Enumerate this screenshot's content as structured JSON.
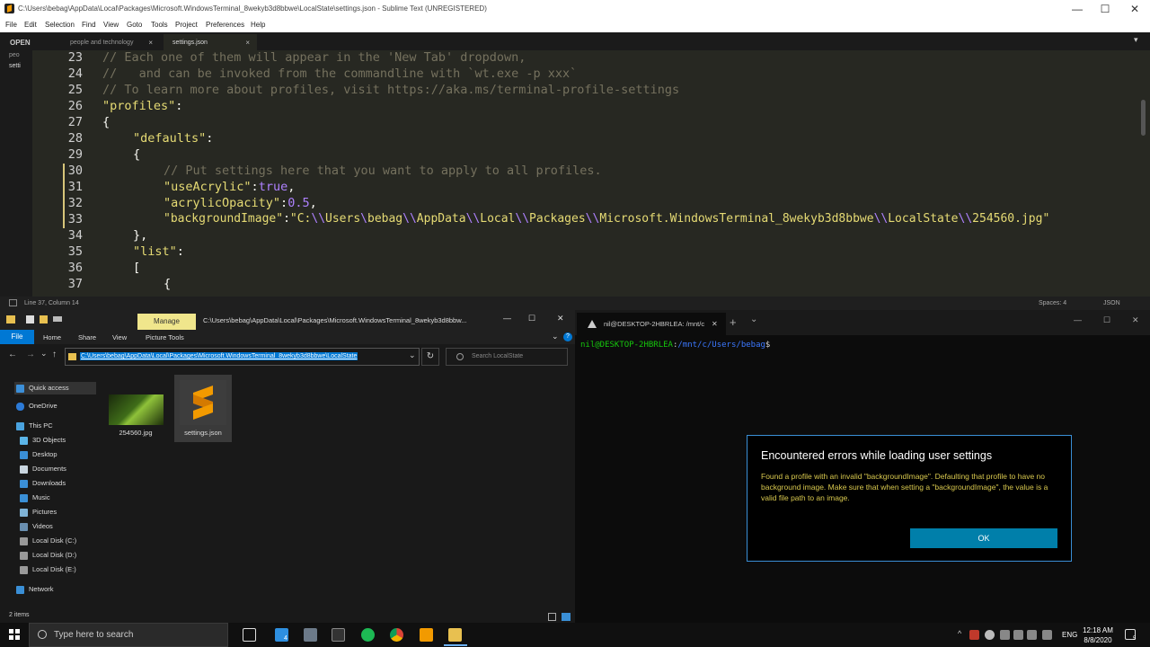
{
  "sublime": {
    "title": "C:\\Users\\bebag\\AppData\\Local\\Packages\\Microsoft.WindowsTerminal_8wekyb3d8bbwe\\LocalState\\settings.json - Sublime Text (UNREGISTERED)",
    "menu": [
      "File",
      "Edit",
      "Selection",
      "Find",
      "View",
      "Goto",
      "Tools",
      "Project",
      "Preferences",
      "Help"
    ],
    "sidebar_header": "OPEN",
    "sidebar_items": [
      "peo",
      "setti"
    ],
    "tabs": [
      {
        "label": "people and technology",
        "close": "×"
      },
      {
        "label": "settings.json",
        "close": "×"
      }
    ],
    "line_numbers": [
      "23",
      "24",
      "25",
      "26",
      "27",
      "28",
      "29",
      "30",
      "31",
      "32",
      "33",
      "34",
      "35",
      "36",
      "37"
    ],
    "status_left": "Line 37, Column 14",
    "status_spaces": "Spaces: 4",
    "status_syntax": "JSON",
    "win_min": "—",
    "win_max": "☐",
    "win_close": "✕",
    "tab_dropdown": "▾"
  },
  "code": {
    "l23": "// Each one of them will appear in the 'New Tab' dropdown,",
    "l24": "//   and can be invoked from the commandline with `wt.exe -p xxx`",
    "l25": "// To learn more about profiles, visit https://aka.ms/terminal-profile-settings",
    "l26_key": "\"profiles\"",
    "l26_colon": ":",
    "l27": "{",
    "l28_key": "\"defaults\"",
    "l28_colon": ":",
    "l29": "{",
    "l30": "// Put settings here that you want to apply to all profiles.",
    "l31_key": "\"useAcrylic\"",
    "l31_colon": ":",
    "l31_val": "true",
    "l31_comma": ",",
    "l32_key": "\"acrylicOpacity\"",
    "l32_colon": ":",
    "l32_val": "0.5",
    "l32_comma": ",",
    "l33_key": "\"backgroundImage\"",
    "l33_colon": ":",
    "l33_p1": "\"C:",
    "l33_e1": "\\\\",
    "l33_p2": "Users",
    "l33_e2": "\\",
    "l33_p3": "bebag",
    "l33_e3": "\\\\",
    "l33_p4": "AppData",
    "l33_e4": "\\\\",
    "l33_p5": "Local",
    "l33_e5": "\\\\",
    "l33_p6": "Packages",
    "l33_e6": "\\\\",
    "l33_p7": "Microsoft.WindowsTerminal_8wekyb3d8bbwe",
    "l33_e7": "\\\\",
    "l33_p8": "LocalState",
    "l33_e8": "\\\\",
    "l33_p9": "254560.jpg\"",
    "l34": "},",
    "l35_key": "\"list\"",
    "l35_colon": ":",
    "l36": "[",
    "l37": "{"
  },
  "explorer": {
    "manage": "Manage",
    "title_path": "C:\\Users\\bebag\\AppData\\Local\\Packages\\Microsoft.WindowsTerminal_8wekyb3d8bbw...",
    "ribbon": {
      "file": "File",
      "home": "Home",
      "share": "Share",
      "view": "View",
      "picture_tools": "Picture Tools"
    },
    "address": "C:\\Users\\bebag\\AppData\\Local\\Packages\\Microsoft.WindowsTerminal_8wekyb3d8bbwe\\LocalState",
    "search_placeholder": "Search LocalState",
    "nav": [
      "Quick access",
      "OneDrive",
      "This PC",
      "3D Objects",
      "Desktop",
      "Documents",
      "Downloads",
      "Music",
      "Pictures",
      "Videos",
      "Local Disk (C:)",
      "Local Disk (D:)",
      "Local Disk (E:)",
      "Network"
    ],
    "files": [
      {
        "name": "254560.jpg"
      },
      {
        "name": "settings.json"
      }
    ],
    "status": "2 items",
    "win_min": "—",
    "win_max": "☐",
    "win_close": "✕",
    "ribbon_chevron": "⌄",
    "help": "?",
    "back": "←",
    "forward": "→",
    "recent": "⌄",
    "up": "↑",
    "addr_drop": "⌄",
    "refresh": "↻"
  },
  "terminal": {
    "tab_label": "nil@DESKTOP-2HBRLEA: /mnt/c",
    "tab_close": "✕",
    "new_tab": "+",
    "dropdown": "⌄",
    "prompt_user": "nil@DESKTOP-2HBRLEA",
    "prompt_sep": ":",
    "prompt_path": "/mnt/c/Users/bebag",
    "prompt_dollar": "$",
    "win_min": "—",
    "win_max": "☐",
    "win_close": "✕",
    "dialog": {
      "title": "Encountered errors while loading user settings",
      "message": "Found a profile with an invalid \"backgroundImage\". Defaulting that profile to have no background image. Make sure that when setting a \"backgroundImage\", the value is a valid file path to an image.",
      "ok": "OK"
    }
  },
  "taskbar": {
    "search_placeholder": "Type here to search",
    "lang": "ENG",
    "time": "12:18 AM",
    "date": "8/8/2020",
    "task_badge": "4",
    "notify_count": "5",
    "tray_up": "^"
  },
  "colors": {
    "accent": "#0078d4",
    "manage_tab": "#f0e68c",
    "dialog_border": "#3a8fd6",
    "dialog_text": "#d8c84e",
    "ok_button": "#007faa"
  }
}
